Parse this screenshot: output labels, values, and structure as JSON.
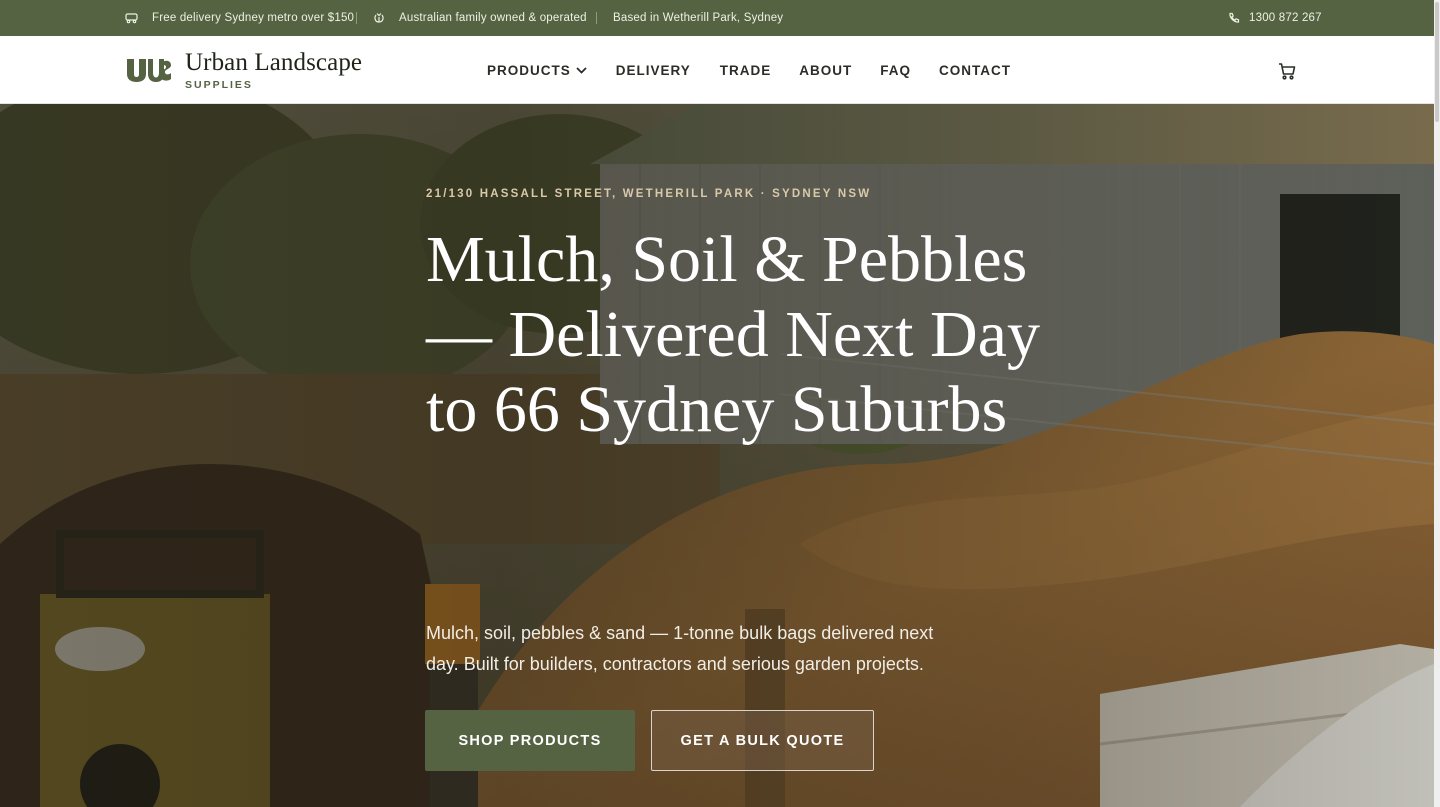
{
  "topbar": {
    "delivery": "Free delivery Sydney metro over $150",
    "family": "Australian family owned & operated",
    "location": "Based in Wetherill Park, Sydney",
    "phone": "1300 872 267"
  },
  "header": {
    "brand": "Urban Landscape",
    "brand_sub": "SUPPLIES",
    "nav": {
      "products": "PRODUCTS",
      "delivery": "DELIVERY",
      "trade": "TRADE",
      "about": "ABOUT",
      "faq": "FAQ",
      "contact": "CONTACT"
    }
  },
  "hero": {
    "eyebrow": "21/130 HASSALL STREET, WETHERILL PARK · SYDNEY NSW",
    "headline": "Mulch, Soil & Pebbles — Delivered Next Day to 66 Sydney Suburbs",
    "lede": "Mulch, soil, pebbles & sand — 1-tonne bulk bags delivered next day. Built for builders, contractors and serious garden projects.",
    "primary_cta": "SHOP PRODUCTS",
    "secondary_cta": "GET A BULK QUOTE"
  },
  "colors": {
    "brand_green": "#566343",
    "topbar_text": "#eef0e4",
    "eyebrow": "#d9c9a9"
  }
}
